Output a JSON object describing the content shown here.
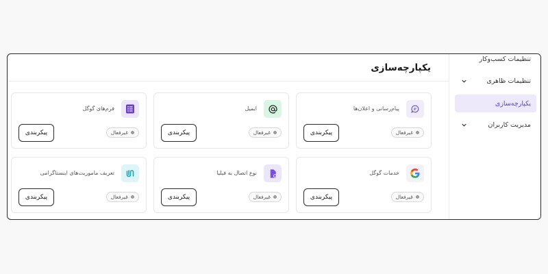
{
  "sidebar": {
    "items": [
      {
        "label": "تنظیمات کسب‌وکار",
        "has_chevron": false,
        "active": false
      },
      {
        "label": "تنظیمات ظاهری",
        "has_chevron": true,
        "active": false
      },
      {
        "label": "یکپارچه‌سازی",
        "has_chevron": false,
        "active": true
      },
      {
        "label": "مدیریت کاربران",
        "has_chevron": true,
        "active": false
      }
    ]
  },
  "main": {
    "title": "یکپارچه‌سازی",
    "cards": [
      {
        "title": "پیام‌رسانی و اعلان‌ها",
        "icon": "chat-bubble-icon",
        "status": "غیرفعال",
        "button": "پیکربندی"
      },
      {
        "title": "ایمیل",
        "icon": "at-sign-icon",
        "status": "غیرفعال",
        "button": "پیکربندی"
      },
      {
        "title": "فرم‌های گوگل",
        "icon": "google-forms-icon",
        "status": "غیرفعال",
        "button": "پیکربندی"
      },
      {
        "title": "خدمات گوگل",
        "icon": "google-icon",
        "status": "غیرفعال",
        "button": "پیکربندی"
      },
      {
        "title": "نوع اتصال به فیلیا",
        "icon": "document-link-icon",
        "status": "غیرفعال",
        "button": "پیکربندی"
      },
      {
        "title": "تعریف ماموریت‌های اینستاگرامی",
        "icon": "swirl-logo-icon",
        "status": "غیرفعال",
        "button": "پیکربندی"
      }
    ]
  },
  "colors": {
    "accent": "#5b3fc4",
    "active_bg": "#ede9fb",
    "border": "#2a2a2a"
  }
}
